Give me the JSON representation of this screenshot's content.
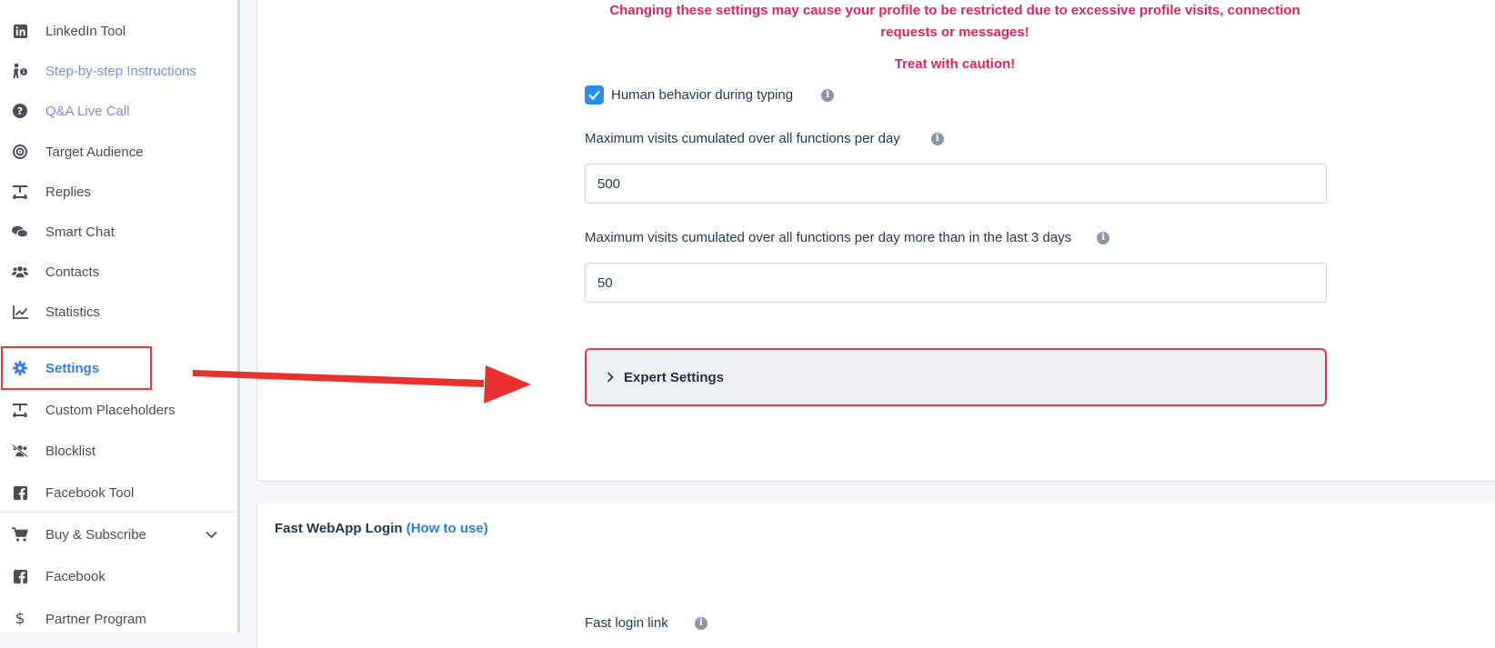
{
  "sidebar": {
    "items": [
      {
        "label": "LinkedIn Tool",
        "icon": "linkedin-icon"
      },
      {
        "label": "Step-by-step Instructions",
        "icon": "person-info-icon"
      },
      {
        "label": "Q&A Live Call",
        "icon": "question-circle-icon"
      },
      {
        "label": "Target Audience",
        "icon": "target-icon"
      },
      {
        "label": "Replies",
        "icon": "replies-icon"
      },
      {
        "label": "Smart Chat",
        "icon": "chat-bubbles-icon"
      },
      {
        "label": "Contacts",
        "icon": "users-icon"
      },
      {
        "label": "Statistics",
        "icon": "chart-line-icon"
      },
      {
        "label": "Settings",
        "icon": "gear-icon"
      },
      {
        "label": "Custom Placeholders",
        "icon": "placeholder-icon"
      },
      {
        "label": "Blocklist",
        "icon": "users-slash-icon"
      },
      {
        "label": "Facebook Tool",
        "icon": "facebook-icon"
      },
      {
        "label": "Buy & Subscribe",
        "icon": "cart-icon"
      },
      {
        "label": "Facebook",
        "icon": "facebook-icon"
      },
      {
        "label": "Partner Program",
        "icon": "dollar-icon"
      }
    ]
  },
  "settings": {
    "warning": "Changing these settings may cause your profile to be restricted due to excessive profile visits, connection requests or messages!",
    "caution": "Treat with caution!",
    "human_behavior": {
      "label": "Human behavior during typing",
      "checked": true
    },
    "max_visits": {
      "label": "Maximum visits cumulated over all functions per day",
      "value": "500"
    },
    "max_visits_last3": {
      "label": "Maximum visits cumulated over all functions per day more than in the last 3 days",
      "value": "50"
    },
    "expert_label": "Expert Settings"
  },
  "fast_login": {
    "title": "Fast WebApp Login",
    "howto": "(How to use)",
    "link_label": "Fast login link"
  },
  "colors": {
    "accent": "#2f7fe6",
    "warning": "#e0245e",
    "highlight": "#e33b3b",
    "link": "#7c8ce0"
  }
}
